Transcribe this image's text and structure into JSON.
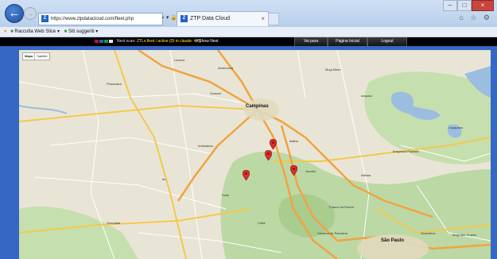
{
  "browser": {
    "url": "https://www.ztpdatacloud.com/fleet.php",
    "address_icons": "⌕ ▾ 🔒 C",
    "tab_title": "ZTP Data Cloud",
    "tab_close": "×",
    "tab_favicon": "Z",
    "window_controls": {
      "minimize": "–",
      "maximize": "□",
      "close": "×"
    },
    "tool_icons": "⌂ ☆ ⚙"
  },
  "favorites_bar": {
    "items": [
      {
        "label": "Raccolta Web Slice ▾"
      },
      {
        "label": "Siti suggeriti ▾"
      }
    ]
  },
  "topnav": {
    "status_prefix": "Next scan:",
    "status_highlight": "ZTLs fleet / active (DI in claude: 4/6)",
    "show_next": "> Show Next",
    "buttons": [
      {
        "label": "Vai para"
      },
      {
        "label": "Página Inicial"
      },
      {
        "label": "Logout"
      }
    ],
    "flag_colors": [
      "#c8102e",
      "#2a5cc7",
      "#1d9a46",
      "#e8e8e8"
    ]
  },
  "map": {
    "map_type": {
      "map": "Mapa",
      "satellite": "Satélite"
    },
    "colors": {
      "land": "#e9e5d6",
      "green": "#bcd8a5",
      "water": "#9bbde0",
      "major_road": "#f3c94a",
      "highway": "#f1a340",
      "marker": "#d9302c"
    },
    "cities": [
      {
        "name": "Campinas",
        "big": true
      },
      {
        "name": "São Paulo",
        "big": true
      },
      {
        "name": "Americana",
        "big": false
      },
      {
        "name": "Limeira",
        "big": false
      },
      {
        "name": "Piracicaba",
        "big": false
      },
      {
        "name": "Sumaré",
        "big": false
      },
      {
        "name": "Indaiatuba",
        "big": false
      },
      {
        "name": "Itu",
        "big": false
      },
      {
        "name": "Sorocaba",
        "big": false
      },
      {
        "name": "Jundiaí",
        "big": false
      },
      {
        "name": "Atibaia",
        "big": false
      },
      {
        "name": "Bragança Paulista",
        "big": false
      },
      {
        "name": "Guarulhos",
        "big": false
      },
      {
        "name": "Mogi das Cruzes",
        "big": false
      },
      {
        "name": "Mogi Mirim",
        "big": false
      },
      {
        "name": "Amparo",
        "big": false
      },
      {
        "name": "Santana de Parnaíba",
        "big": false
      },
      {
        "name": "Franco da Rocha",
        "big": false
      },
      {
        "name": "Caçapava",
        "big": false
      },
      {
        "name": "Itatiba",
        "big": false
      },
      {
        "name": "Salto",
        "big": false
      },
      {
        "name": "Cotia",
        "big": false
      }
    ]
  }
}
